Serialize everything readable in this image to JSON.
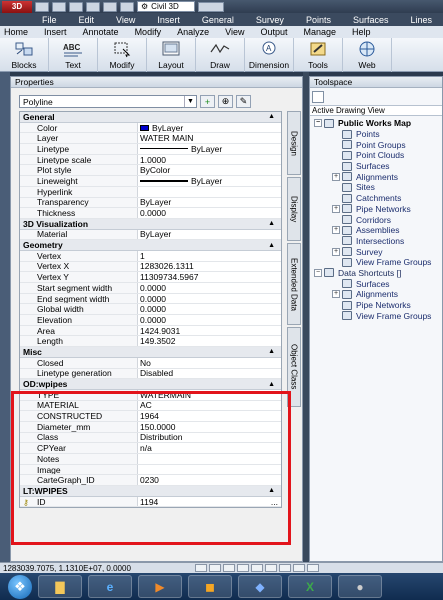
{
  "titlebar": {
    "app_logo": "3D",
    "workspace": "Civil 3D"
  },
  "menubar": [
    "File",
    "Edit",
    "View",
    "Insert",
    "General",
    "Survey",
    "Points",
    "Surfaces",
    "Lines"
  ],
  "ribbon_tabs": [
    "Home",
    "Insert",
    "Annotate",
    "Modify",
    "Analyze",
    "View",
    "Output",
    "Manage",
    "Help"
  ],
  "ribbon_panels": [
    {
      "label": "Blocks",
      "icon": "blocks-icon"
    },
    {
      "label": "Text",
      "icon": "text-abc-icon"
    },
    {
      "label": "Modify",
      "icon": "modify-icon"
    },
    {
      "label": "Layout",
      "icon": "layout-icon"
    },
    {
      "label": "Draw",
      "icon": "draw-icon"
    },
    {
      "label": "Dimension",
      "icon": "dimension-icon"
    },
    {
      "label": "Tools",
      "icon": "tools-icon"
    },
    {
      "label": "Web",
      "icon": "web-icon"
    }
  ],
  "properties": {
    "title": "Properties",
    "object_type": "Polyline",
    "side_tabs": [
      "Design",
      "Display",
      "Extended Data",
      "Object Class"
    ],
    "general": {
      "label": "General",
      "rows": [
        {
          "k": "Color",
          "v": "ByLayer",
          "swatch": "#0000cc"
        },
        {
          "k": "Layer",
          "v": "WATER MAIN"
        },
        {
          "k": "Linetype",
          "v": "ByLayer",
          "line": "thin"
        },
        {
          "k": "Linetype scale",
          "v": "1.0000"
        },
        {
          "k": "Plot style",
          "v": "ByColor"
        },
        {
          "k": "Lineweight",
          "v": "ByLayer",
          "line": "thick"
        },
        {
          "k": "Hyperlink",
          "v": ""
        },
        {
          "k": "Transparency",
          "v": "ByLayer"
        },
        {
          "k": "Thickness",
          "v": "0.0000"
        }
      ]
    },
    "viz3d": {
      "label": "3D Visualization",
      "rows": [
        {
          "k": "Material",
          "v": "ByLayer"
        }
      ]
    },
    "geometry": {
      "label": "Geometry",
      "rows": [
        {
          "k": "Vertex",
          "v": "1"
        },
        {
          "k": "Vertex X",
          "v": "1283026.1311"
        },
        {
          "k": "Vertex Y",
          "v": "11309734.5967"
        },
        {
          "k": "Start segment width",
          "v": "0.0000"
        },
        {
          "k": "End segment width",
          "v": "0.0000"
        },
        {
          "k": "Global width",
          "v": "0.0000"
        },
        {
          "k": "Elevation",
          "v": "0.0000"
        },
        {
          "k": "Area",
          "v": "1424.9031"
        },
        {
          "k": "Length",
          "v": "149.3502"
        }
      ]
    },
    "misc": {
      "label": "Misc",
      "rows": [
        {
          "k": "Closed",
          "v": "No"
        },
        {
          "k": "Linetype generation",
          "v": "Disabled"
        }
      ]
    },
    "odwpipes": {
      "label": "OD:wpipes",
      "rows": [
        {
          "k": "TYPE",
          "v": "WATERMAIN"
        },
        {
          "k": "MATERIAL",
          "v": "AC"
        },
        {
          "k": "CONSTRUCTED",
          "v": "1964"
        },
        {
          "k": "Diameter_mm",
          "v": "150.0000"
        },
        {
          "k": "Class",
          "v": "Distribution"
        },
        {
          "k": "CPYear",
          "v": "n/a"
        },
        {
          "k": "Notes",
          "v": ""
        },
        {
          "k": "Image",
          "v": ""
        },
        {
          "k": "CarteGraph_ID",
          "v": "0230"
        }
      ]
    },
    "ltwpipes": {
      "label": "LT:WPIPES",
      "rows": [
        {
          "k": "ID",
          "v": "1194",
          "key": true,
          "dots": "..."
        }
      ]
    }
  },
  "toolspace": {
    "title": "Toolspace",
    "tab": "Active Drawing View",
    "tree": [
      {
        "label": "Public Works Map",
        "level": 0,
        "pm": "−",
        "root": true
      },
      {
        "label": "Points",
        "level": 1,
        "pm": ""
      },
      {
        "label": "Point Groups",
        "level": 1,
        "pm": ""
      },
      {
        "label": "Point Clouds",
        "level": 1,
        "pm": ""
      },
      {
        "label": "Surfaces",
        "level": 1,
        "pm": ""
      },
      {
        "label": "Alignments",
        "level": 1,
        "pm": "+"
      },
      {
        "label": "Sites",
        "level": 1,
        "pm": ""
      },
      {
        "label": "Catchments",
        "level": 1,
        "pm": ""
      },
      {
        "label": "Pipe Networks",
        "level": 1,
        "pm": "+"
      },
      {
        "label": "Corridors",
        "level": 1,
        "pm": ""
      },
      {
        "label": "Assemblies",
        "level": 1,
        "pm": "+"
      },
      {
        "label": "Intersections",
        "level": 1,
        "pm": ""
      },
      {
        "label": "Survey",
        "level": 1,
        "pm": "+"
      },
      {
        "label": "View Frame Groups",
        "level": 1,
        "pm": ""
      },
      {
        "label": "Data Shortcuts []",
        "level": 0,
        "pm": "−",
        "root": false
      },
      {
        "label": "Surfaces",
        "level": 1,
        "pm": ""
      },
      {
        "label": "Alignments",
        "level": 1,
        "pm": "+"
      },
      {
        "label": "Pipe Networks",
        "level": 1,
        "pm": ""
      },
      {
        "label": "View Frame Groups",
        "level": 1,
        "pm": ""
      }
    ]
  },
  "statusbar": {
    "coords": "1283039.7075, 1.1310E+07, 0.0000"
  },
  "taskbar": {
    "apps": [
      "start-orb",
      "explorer",
      "internet-explorer",
      "media-player",
      "outlook",
      "autocad",
      "excel",
      "other"
    ]
  },
  "colors": {
    "highlight": "#e2141b",
    "color_swatch": "#0000cc"
  }
}
